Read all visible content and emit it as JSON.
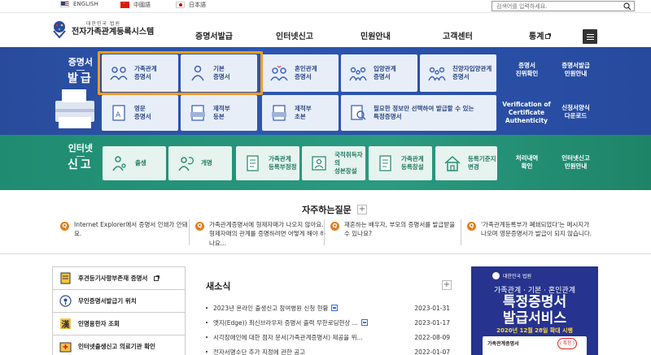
{
  "top": {
    "languages": [
      "ENGLISH",
      "中國語",
      "日本語"
    ],
    "search_placeholder": "검색어를 입력하세요."
  },
  "header": {
    "logo_small": "대한민국 법원",
    "logo_title": "전자가족관계등록시스템",
    "nav": [
      "증명서발급",
      "인터넷신고",
      "민원안내",
      "고객센터",
      "통계"
    ]
  },
  "cert": {
    "title_1": "증명서",
    "title_2": "발급",
    "tiles": [
      {
        "label": "가족관계\n증명서",
        "icon": "family-icon"
      },
      {
        "label": "기본\n증명서",
        "icon": "person-icon"
      },
      {
        "label": "혼인관계\n증명서",
        "icon": "marriage-icon"
      },
      {
        "label": "입양관계\n증명서",
        "icon": "adoption-icon"
      },
      {
        "label": "친양자입양관계\n증명서",
        "icon": "full-adoption-icon"
      },
      {
        "label": "영문\n증명서",
        "icon": "english-doc-icon"
      },
      {
        "label": "제적부\n등본",
        "icon": "register-copy-icon"
      },
      {
        "label": "제적부\n초본",
        "icon": "register-extract-icon"
      },
      {
        "label": "필요한 정보만 선택하여 발급할 수 있는\n특정증명서",
        "icon": "search-doc-icon"
      }
    ],
    "side_links": [
      "증명서\n진위확인",
      "증명서발급\n민원안내",
      "Verification of\nCertificate\nAuthenticity",
      "신청서양식\n다운로드"
    ]
  },
  "report": {
    "title_1": "인터넷",
    "title_2": "신고",
    "tiles": [
      {
        "label": "출생",
        "icon": "birth-icon"
      },
      {
        "label": "개명",
        "icon": "rename-icon"
      },
      {
        "label": "가족관계\n등록부정정",
        "icon": "correction-icon"
      },
      {
        "label": "국적취득자의\n성본창설",
        "icon": "nationality-icon"
      },
      {
        "label": "가족관계\n등록창설",
        "icon": "registry-create-icon"
      },
      {
        "label": "등록기준지\n변경",
        "icon": "house-icon"
      }
    ],
    "side_links": [
      "처리내역\n확인",
      "인터넷신고\n민원안내"
    ]
  },
  "faq": {
    "title": "자주하는질문",
    "items": [
      "Internet Explorer에서 증명서 인쇄가 안돼요.",
      "가족관계증명서에 형제자매가 나오지 않아요. 형제자매의 관계를 증명하려면 어떻게 해야 하나요...",
      "재혼하는 배우자, 부모의 증명서를 발급받을 수 있나요?",
      "'가족관계등록부가 폐쇄되었다'는 메시지가 나오며 영문증명서가 발급이 되지 않습니다."
    ]
  },
  "quick": [
    {
      "label": "후견등기사항부존재 증명서",
      "icon": "certificate-icon"
    },
    {
      "label": "무인증명서발급기 위치",
      "icon": "location-icon"
    },
    {
      "label": "인명용한자 조회",
      "icon": "hanja-icon"
    },
    {
      "label": "인터넷출생신고 의료기관 확인",
      "icon": "hospital-icon"
    }
  ],
  "news": {
    "title": "새소식",
    "items": [
      {
        "text": "2023년 온라인 출생신고 참여병원 신청 현황",
        "date": "2023-01-31",
        "new": true
      },
      {
        "text": "엣지(Edge)) 최신브라우저 증명서 출력 무한로딩현상 ...",
        "date": "2023-01-17",
        "new": true
      },
      {
        "text": "시각장애인에 대한 점자 문서(가족관계증명서) 제공을 위...",
        "date": "2022-08-09",
        "new": false
      },
      {
        "text": "전자서명수단 추가 지정에 관한 공고",
        "date": "2022-01-07",
        "new": false
      }
    ]
  },
  "banner": {
    "org": "대한민국 법원",
    "subtitle": "가족관계 · 기본 · 혼인관계",
    "main_1": "특정증명서",
    "main_2": "발급서비스",
    "date": "2020년 12월 28일 확대 시행",
    "card": "가족관계증명서",
    "card_badge": "( 특정 )"
  }
}
